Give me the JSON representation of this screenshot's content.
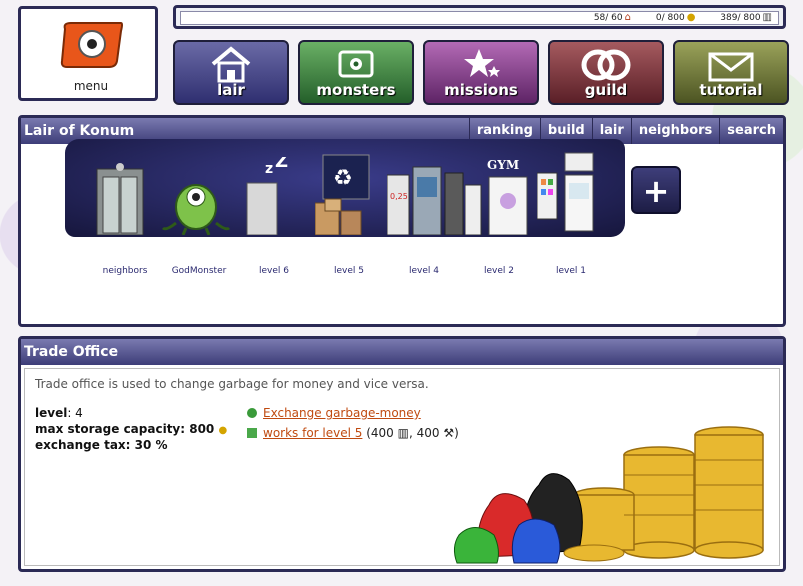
{
  "logo": {
    "label": "menu"
  },
  "stats": {
    "houses": "58/ 60",
    "money": "0/ 800",
    "garbage": "389/ 800"
  },
  "nav": [
    {
      "label": "lair",
      "icon": "house-icon"
    },
    {
      "label": "monsters",
      "icon": "monster-card-icon"
    },
    {
      "label": "missions",
      "icon": "stars-icon"
    },
    {
      "label": "guild",
      "icon": "rings-icon"
    },
    {
      "label": "tutorial",
      "icon": "envelope-icon"
    }
  ],
  "lair_panel": {
    "title": "Lair of Konum",
    "tabs": [
      "ranking",
      "build",
      "lair",
      "neighbors",
      "search"
    ],
    "active_tab": "lair",
    "rooms": [
      "neighbors",
      "GodMonster",
      "level 6",
      "level 5",
      "level 4",
      "level 2",
      "level 1"
    ],
    "add_label": "+"
  },
  "trade_panel": {
    "title": "Trade Office",
    "description": "Trade office is used to change garbage for money and vice versa.",
    "level_label": "level",
    "level_value": ": 4",
    "capacity": "max storage capacity: 800",
    "tax": "exchange tax: 30 %",
    "link1": "Exchange garbage-money",
    "link2": "works for level 5",
    "link2_tail_a": " (400 ",
    "link2_tail_b": ", 400 ",
    "link2_tail_c": ")"
  }
}
